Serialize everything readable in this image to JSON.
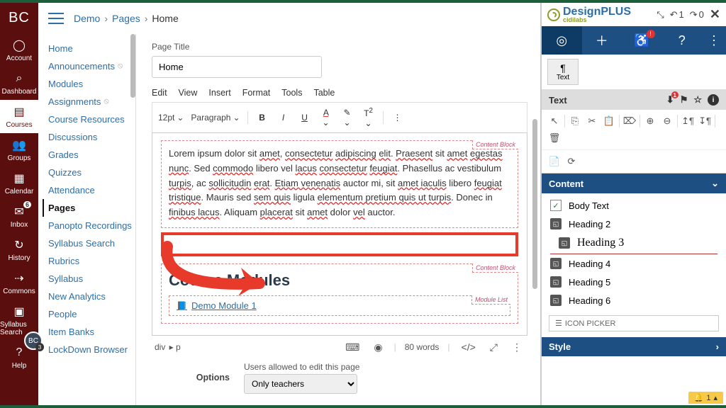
{
  "rail": {
    "logo": "BC",
    "items": [
      {
        "icon": "◯",
        "label": "Account"
      },
      {
        "icon": "⌕",
        "label": "Dashboard"
      },
      {
        "icon": "▤",
        "label": "Courses",
        "active": true
      },
      {
        "icon": "👥",
        "label": "Groups"
      },
      {
        "icon": "▦",
        "label": "Calendar"
      },
      {
        "icon": "✉",
        "label": "Inbox",
        "badge": "6"
      },
      {
        "icon": "↻",
        "label": "History"
      },
      {
        "icon": "⇢",
        "label": "Commons"
      },
      {
        "icon": "▣",
        "label": "Syllabus Search"
      },
      {
        "icon": "?",
        "label": "Help"
      }
    ],
    "avatar": "BC",
    "avatar_badge": "3"
  },
  "breadcrumb": {
    "course": "Demo",
    "section": "Pages",
    "page": "Home"
  },
  "coursenav": [
    {
      "label": "Home"
    },
    {
      "label": "Announcements",
      "hidden": true
    },
    {
      "label": "Modules"
    },
    {
      "label": "Assignments",
      "hidden": true
    },
    {
      "label": "Course Resources"
    },
    {
      "label": "Discussions"
    },
    {
      "label": "Grades"
    },
    {
      "label": "Quizzes"
    },
    {
      "label": "Attendance"
    },
    {
      "label": "Pages",
      "active": true
    },
    {
      "label": "Panopto Recordings"
    },
    {
      "label": "Syllabus Search"
    },
    {
      "label": "Rubrics"
    },
    {
      "label": "Syllabus"
    },
    {
      "label": "New Analytics"
    },
    {
      "label": "People"
    },
    {
      "label": "Item Banks"
    },
    {
      "label": "LockDown Browser"
    }
  ],
  "editor": {
    "page_title_label": "Page Title",
    "page_title_value": "Home",
    "menus": [
      "Edit",
      "View",
      "Insert",
      "Format",
      "Tools",
      "Table"
    ],
    "font_size": "12pt",
    "para_style": "Paragraph",
    "content_block_label": "Content Block",
    "lorem": "Lorem ipsum dolor sit amet, consectetur adipiscing elit. Praesent sit amet egestas nunc. Sed commodo libero vel lacus consectetur feugiat. Phasellus ac vestibulum turpis, ac sollicitudin erat. Etiam venenatis auctor mi, sit amet iaculis libero feugiat tristique. Mauris sed sem quis ligula elementum pretium quis ut turpis. Donec in finibus lacus. Aliquam placerat sit amet dolor vel auctor.",
    "heading": "Course Modules",
    "module_list_label": "Module List",
    "module_link": "Demo Module 1",
    "path": [
      "div",
      "p"
    ],
    "word_count": "80 words",
    "options_label": "Options",
    "users_allowed_label": "Users allowed to edit this page",
    "users_allowed_value": "Only teachers"
  },
  "dpl": {
    "brand": "DesignPLUS",
    "brand_sub": "cidilabs",
    "undo": "1",
    "redo": "0",
    "subtab": "Text",
    "section_text": "Text",
    "section_content": "Content",
    "section_style": "Style",
    "content_items": [
      {
        "label": "Body Text",
        "checked": true
      },
      {
        "label": "Heading 2"
      },
      {
        "label": "Heading 3",
        "h3": true
      },
      {
        "label": "Heading 4"
      },
      {
        "label": "Heading 5"
      },
      {
        "label": "Heading 6"
      }
    ],
    "icon_picker": "ICON PICKER",
    "toast": "1"
  }
}
